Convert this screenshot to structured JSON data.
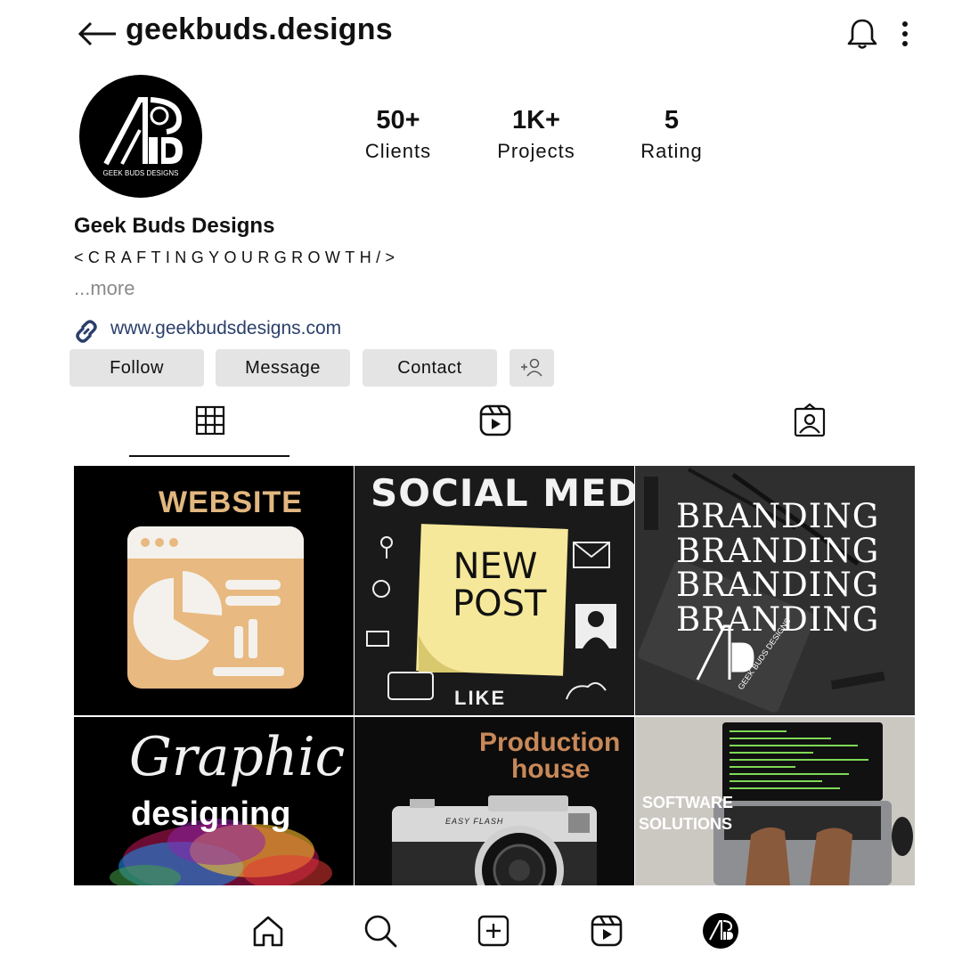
{
  "header": {
    "username": "geekbuds.designs",
    "icons": [
      "back-arrow-icon",
      "bell-icon",
      "more-vertical-icon"
    ]
  },
  "profile": {
    "avatar_text": "GEEK BUDS DESIGNS",
    "stats": [
      {
        "value": "50+",
        "label": "Clients"
      },
      {
        "value": "1K+",
        "label": "Projects"
      },
      {
        "value": "5",
        "label": "Rating"
      }
    ],
    "name": "Geek Buds Designs",
    "bio": "<CRAFTINGYOURGROWTH/>",
    "more": "...more",
    "website": "www.geekbudsdesigns.com"
  },
  "actions": {
    "follow": "Follow",
    "message": "Message",
    "contact": "Contact"
  },
  "tabs": [
    "grid-icon",
    "reels-icon",
    "tagged-icon"
  ],
  "posts": [
    {
      "title": "WEBSITE"
    },
    {
      "title": "SOCIAL MEDIA",
      "note": "NEW POST",
      "footer": "LIKE"
    },
    {
      "lines": [
        "BRANDING",
        "BRANDING",
        "BRANDING",
        "BRANDING"
      ],
      "logo_text": "GEEK BUDS DESIGNS"
    },
    {
      "title": "Graphic",
      "subtitle": "designing"
    },
    {
      "title": "Production",
      "subtitle": "house",
      "camera_text": "EASY FLASH"
    },
    {
      "title": "SOFTWARE",
      "subtitle": "SOLUTIONS"
    }
  ],
  "bottom_nav": [
    "home-icon",
    "search-icon",
    "create-icon",
    "reels-icon",
    "profile-avatar"
  ],
  "colors": {
    "button_bg": "#e4e4e4",
    "link": "#2a3f6b",
    "muted": "#8a8a8a",
    "accent_tan": "#e2b77f",
    "production_orange": "#c88858"
  }
}
